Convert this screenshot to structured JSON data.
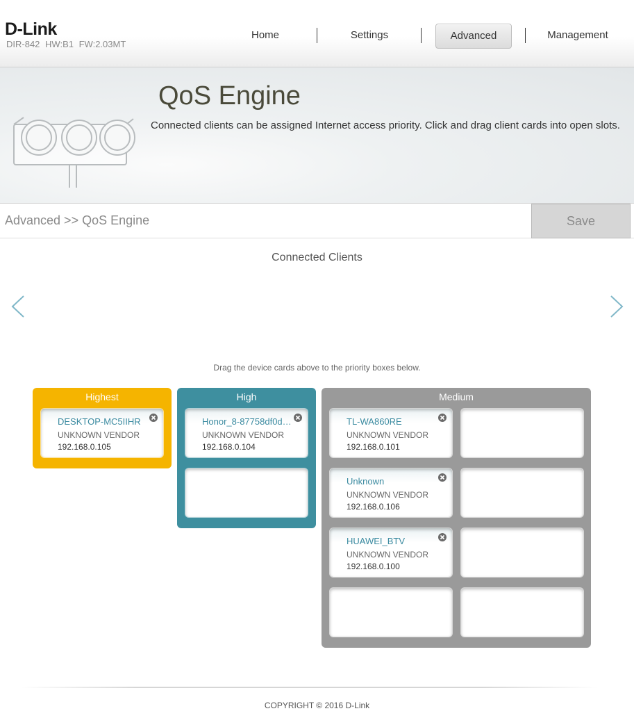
{
  "brand": {
    "logo": "D-Link",
    "model": "DIR-842",
    "hw": "HW:B1",
    "fw": "FW:2.03MT"
  },
  "nav": {
    "home": "Home",
    "settings": "Settings",
    "advanced": "Advanced",
    "management": "Management"
  },
  "banner": {
    "title": "QoS Engine",
    "description": "Connected clients can be assigned Internet access priority. Click and drag client cards into open slots."
  },
  "breadcrumb": "Advanced >> QoS Engine",
  "save_label": "Save",
  "clients_title": "Connected Clients",
  "drag_hint": "Drag the device cards above to the priority boxes below.",
  "priority": {
    "highest": {
      "label": "Highest",
      "cards": [
        {
          "name": "DESKTOP-MC5IIHR",
          "vendor": "UNKNOWN VENDOR",
          "ip": "192.168.0.105"
        }
      ]
    },
    "high": {
      "label": "High",
      "cards": [
        {
          "name": "Honor_8-87758df0d7...",
          "vendor": "UNKNOWN VENDOR",
          "ip": "192.168.0.104"
        }
      ]
    },
    "medium": {
      "label": "Medium",
      "cards": [
        {
          "name": "TL-WA860RE",
          "vendor": "UNKNOWN VENDOR",
          "ip": "192.168.0.101"
        },
        {
          "name": "Unknown",
          "vendor": "UNKNOWN VENDOR",
          "ip": "192.168.0.106"
        },
        {
          "name": "HUAWEI_BTV",
          "vendor": "UNKNOWN VENDOR",
          "ip": "192.168.0.100"
        }
      ]
    }
  },
  "footer": {
    "copyright": "COPYRIGHT © 2016 D-Link"
  },
  "colors": {
    "highest": "#f5b400",
    "high": "#3e8f9f",
    "medium": "#9a9a9a",
    "accent_text": "#3a8aa0"
  }
}
